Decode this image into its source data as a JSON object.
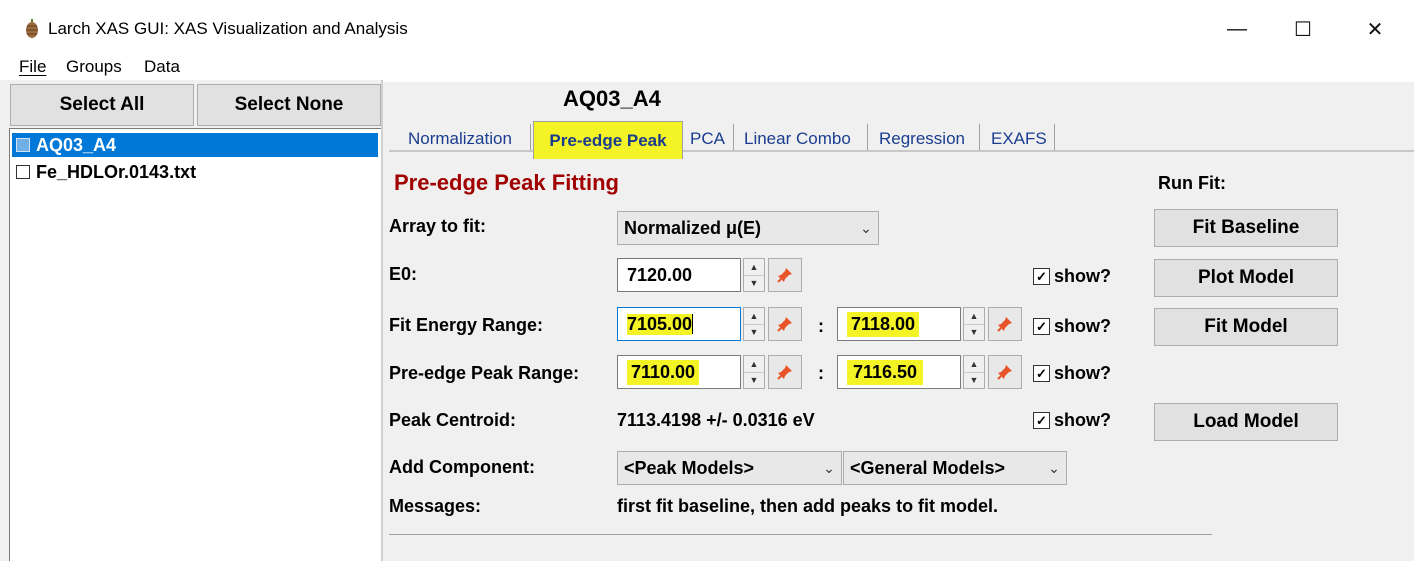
{
  "window": {
    "title": "Larch XAS GUI: XAS Visualization and Analysis",
    "icon": "pinecone-icon",
    "controls": {
      "minimize": "—",
      "maximize": "☐",
      "close": "✕"
    }
  },
  "menubar": [
    "File",
    "Groups",
    "Data"
  ],
  "left_panel": {
    "select_all_label": "Select All",
    "select_none_label": "Select None",
    "files": [
      {
        "name": "AQ03_A4",
        "selected": true,
        "checked": false
      },
      {
        "name": "Fe_HDLOr.0143.txt",
        "selected": false,
        "checked": false
      }
    ]
  },
  "right_panel": {
    "group_title": "AQ03_A4",
    "tabs": [
      "Normalization",
      "Pre-edge Peak",
      "PCA",
      "Linear Combo",
      "Regression",
      "EXAFS"
    ],
    "active_tab": "Pre-edge Peak",
    "heading": "Pre-edge Peak Fitting",
    "run_fit_label": "Run Fit:",
    "array_to_fit": {
      "label": "Array to fit:",
      "value": "Normalized μ(E)"
    },
    "e0": {
      "label": "E0:",
      "value": "7120.00",
      "show_label": "show?"
    },
    "fit_energy_range": {
      "label": "Fit Energy Range:",
      "min": "7105.00",
      "max": "7118.00",
      "show_label": "show?"
    },
    "preedge_peak_range": {
      "label": "Pre-edge Peak Range:",
      "min": "7110.00",
      "max": "7116.50",
      "show_label": "show?"
    },
    "peak_centroid": {
      "label": "Peak Centroid:",
      "value": "7113.4198 +/- 0.0316 eV",
      "show_label": "show?"
    },
    "add_component": {
      "label": "Add Component:",
      "peak_models": "<Peak Models>",
      "general_models": "<General Models>"
    },
    "messages": {
      "label": "Messages:",
      "value": "first fit baseline, then add peaks to fit model."
    },
    "separator": ":",
    "buttons": {
      "fit_baseline": "Fit Baseline",
      "plot_model": "Plot Model",
      "fit_model": "Fit Model",
      "load_model": "Load Model"
    }
  },
  "colors": {
    "highlight": "#f3f325",
    "heading": "#a00000",
    "tab_text": "#1a3d8f",
    "selection": "#0078d7"
  }
}
